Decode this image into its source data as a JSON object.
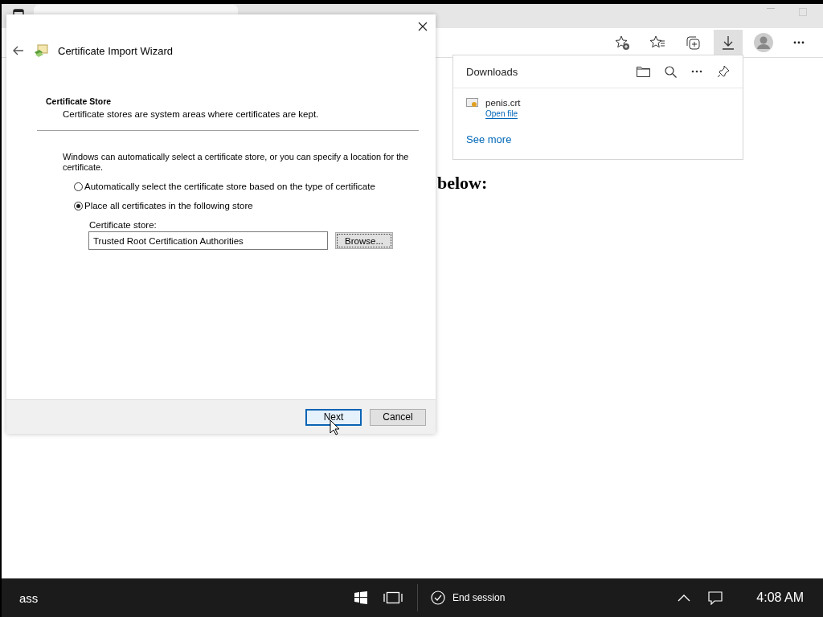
{
  "browser": {
    "downloads_active": true,
    "page_text": "below:"
  },
  "downloads": {
    "title": "Downloads",
    "items": [
      {
        "name": "penis.crt",
        "action": "Open file"
      }
    ],
    "see_more": "See more"
  },
  "wizard": {
    "title": "Certificate Import Wizard",
    "heading": "Certificate Store",
    "subheading": "Certificate stores are system areas where certificates are kept.",
    "intro": "Windows can automatically select a certificate store, or you can specify a location for the certificate.",
    "options": [
      {
        "label": "Automatically select the certificate store based on the type of certificate",
        "selected": false
      },
      {
        "label": "Place all certificates in the following store",
        "selected": true
      }
    ],
    "store_label": "Certificate store:",
    "store_value": "Trusted Root Certification Authorities",
    "browse": "Browse...",
    "buttons": [
      {
        "label": "Next",
        "default": true
      },
      {
        "label": "Cancel",
        "default": false
      }
    ]
  },
  "taskbar": {
    "user": "ass",
    "session": "End session",
    "clock": "4:08 AM"
  }
}
